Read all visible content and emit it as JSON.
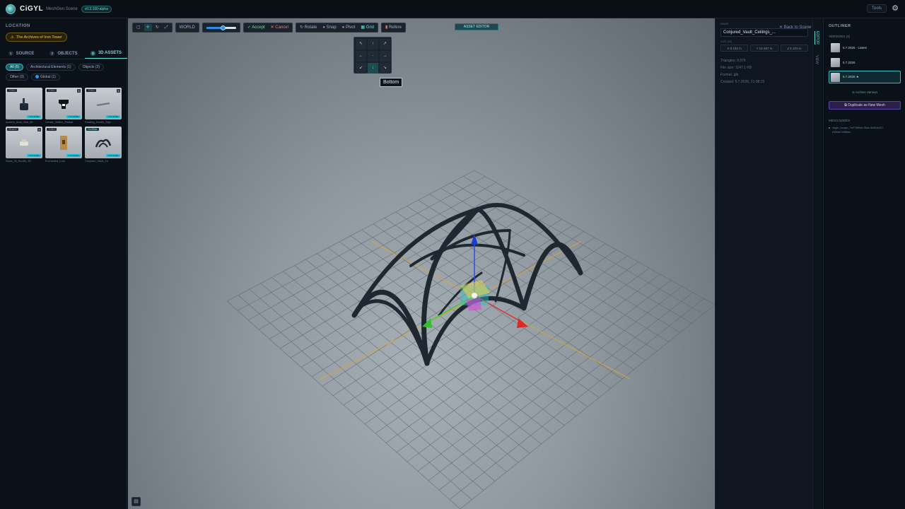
{
  "app": {
    "brand": "CiGYL",
    "subtitle": "MeshGen Scene",
    "version": "v0.3.100-alpha",
    "tools_label": "Tools"
  },
  "left": {
    "location_label": "LOCATION",
    "location_value": "The Archives of Iron Tower",
    "tabs": [
      {
        "num": "1",
        "label": "SOURCE"
      },
      {
        "num": "2",
        "label": "OBJECTS"
      },
      {
        "num": "3",
        "label": "3D ASSETS"
      }
    ],
    "filters": [
      {
        "label": "All (6)",
        "active": true
      },
      {
        "label": "Architectural Elements (1)",
        "active": false
      },
      {
        "label": "Objects (2)",
        "active": false
      },
      {
        "label": "Other (3)",
        "active": false
      },
      {
        "label": "Global (1)",
        "active": false
      }
    ],
    "assets": [
      {
        "tag": "TODO",
        "name": "Ancient_Anvil_Stat_3D",
        "level": "1 IN LEVEL"
      },
      {
        "tag": "TODO",
        "name": "Ornate_Hellion_Pedest",
        "level": "1 IN LEVEL"
      },
      {
        "tag": "TODO",
        "name": "Floating_Scrolls_Sign",
        "level": "1 IN LEVEL"
      },
      {
        "tag": "READY",
        "name": "Stack_Of_Scrolls_3D",
        "level": "1 IN LEVEL"
      },
      {
        "tag": "TODO",
        "name": "Enchanted_Lock",
        "level": "1 IN LEVEL"
      },
      {
        "tag": "GLOBAL",
        "name": "Conjured_Vault_Ce",
        "level": "1 IN LEVEL"
      }
    ]
  },
  "toolbar": {
    "world": "WORLD",
    "accept": "✓ Accept",
    "cancel": "✕ Cancel",
    "rotate": "↻ Rotate",
    "snap": "Snap",
    "pivot": "Pivot",
    "grid": "▦ Grid",
    "reference": "Refere",
    "asset_edit": "ASSET EDITOR",
    "slider_value": 0.55,
    "tooltip": "Bottom",
    "navpad": [
      "↖",
      "↑",
      "↗",
      "←",
      "·",
      "→",
      "↙",
      "↓",
      "↘"
    ]
  },
  "props": {
    "name_label": "NAME",
    "name_value": "Conjured_Vault_Ceilings_...",
    "back": "✕ Back to Scene",
    "size_label": "SIZE (M)",
    "dims": [
      "X 8.102 m",
      "Y 15.487 m",
      "Z 5.103 m"
    ],
    "triangles": "Triangles: 9,976",
    "filesize": "File size: 1147.1 KB",
    "format": "Format: glb",
    "created": "Created: 5.7.2026, 21:08:15",
    "side_tab_1": "EDITOR",
    "side_tab_2": "VIEW"
  },
  "outliner": {
    "title": "OUTLINER",
    "versions_label": "VERSIONS (3)",
    "versions": [
      {
        "label": "5.7.2026 · Latest"
      },
      {
        "label": "5.7.2026"
      },
      {
        "label": "5.7.2026 ★"
      }
    ],
    "archive": "⊘ Archive Version",
    "duplicate": "⧉ Duplicate as New Mesh",
    "mesh_nodes_label": "MESH NODES",
    "mesh_node": "virgin_scope_7e27fb0ee-f3ae-4bf8-bd27-e300d7269bec"
  }
}
